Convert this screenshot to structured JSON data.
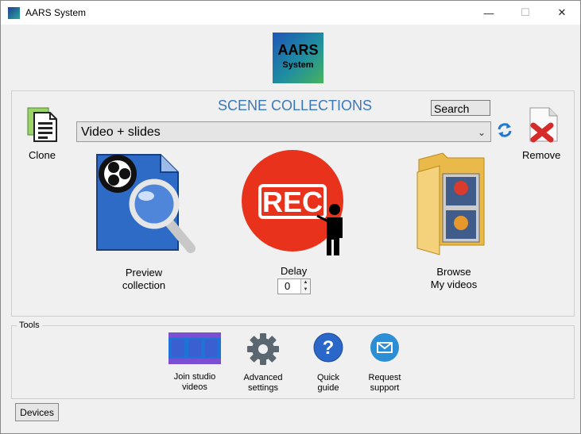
{
  "window": {
    "title": "AARS System",
    "minimize": "—",
    "maximize": "☐",
    "close": "✕"
  },
  "logo": {
    "line1": "AARS",
    "line2": "System"
  },
  "scene": {
    "title": "SCENE COLLECTIONS",
    "search_label": "Search",
    "selected_collection": "Video + slides",
    "clone_label": "Clone",
    "remove_label": "Remove",
    "preview_line1": "Preview",
    "preview_line2": "collection",
    "delay_label": "Delay",
    "delay_value": "0",
    "browse_line1": "Browse",
    "browse_line2": "My videos",
    "rec_text": "REC"
  },
  "tools": {
    "label": "Tools",
    "items": [
      {
        "line1": "Join studio",
        "line2": "videos",
        "icon": "film-strip-icon"
      },
      {
        "line1": "Advanced",
        "line2": "settings",
        "icon": "gear-icon"
      },
      {
        "line1": "Quick",
        "line2": "guide",
        "icon": "help-icon"
      },
      {
        "line1": "Request",
        "line2": "support",
        "icon": "mail-icon"
      }
    ]
  },
  "devices_label": "Devices",
  "colors": {
    "accent_title": "#3a78b8",
    "rec_red": "#e8321c",
    "help_blue": "#2a67c9",
    "support_blue": "#2c8fd6"
  }
}
